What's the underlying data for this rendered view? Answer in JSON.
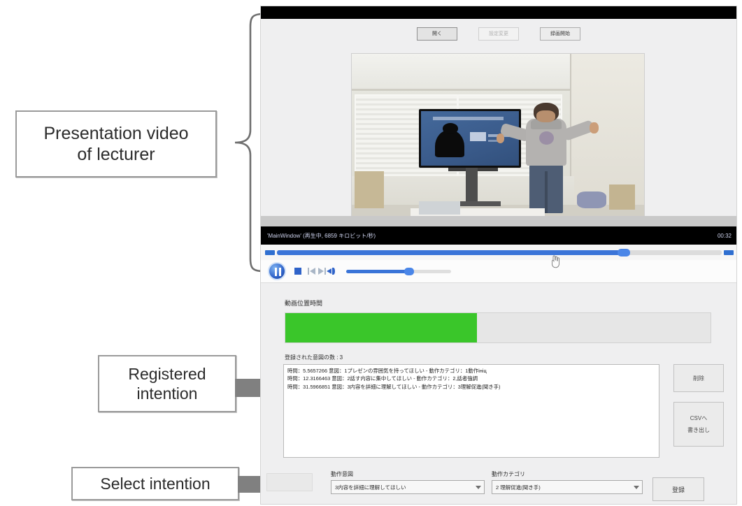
{
  "annotations": {
    "video_callout": "Presentation video\nof lecturer",
    "registered_callout": "Registered\nintention",
    "select_callout": "Select intention"
  },
  "app": {
    "toolbar": {
      "open_label": "開く",
      "middle_label": "設定変更",
      "right_label": "録画開始"
    },
    "video": {
      "status_text": "'MainWindow' (再生中, 6859 キロビット/秒)",
      "elapsed_time": "00:32",
      "seek_percent": 78,
      "volume_percent": 60,
      "scene_description": "lecturer standing beside a display in a seminar room"
    },
    "panel": {
      "progress_label": "動画位置時間",
      "progress_percent": 45,
      "progress_color": "#3ac62a",
      "count_label": "登録された意図の数 : 3",
      "intention_rows": [
        "時間：5.5657266 意図：1プレゼンの雰囲気を持ってほしい - 動作カテゴリ：1動作ініц",
        "時間：12.3166463 意図：2話す内容に集中してほしい - 動作カテゴリ：2,話者強調",
        "時間：31.5966851 意図：3内容を詳細に理解してほしい - 動作カテゴリ：3理解促進(聞き手)"
      ],
      "delete_label": "削除",
      "csv_label_line1": "CSVへ",
      "csv_label_line2": "書き出し",
      "intention_field_label": "動作意図",
      "intention_selected": "3内容を詳細に理解してほしい",
      "category_field_label": "動作カテゴリ",
      "category_selected": "2 理解促進(聞き手)",
      "register_label": "登録"
    }
  }
}
